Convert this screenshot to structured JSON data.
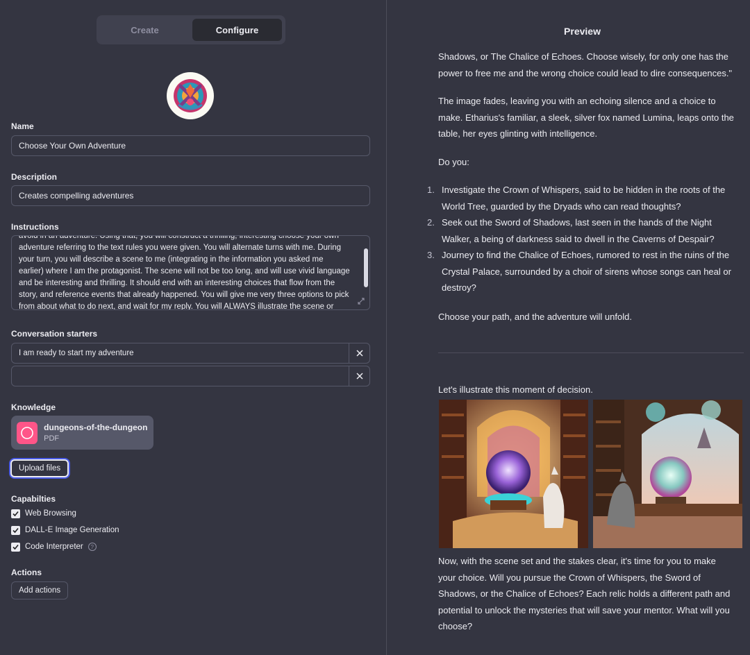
{
  "tabs": [
    {
      "label": "Create",
      "active": false
    },
    {
      "label": "Configure",
      "active": true
    }
  ],
  "form": {
    "name_label": "Name",
    "name_value": "Choose Your Own Adventure",
    "description_label": "Description",
    "description_value": "Creates compelling adventures",
    "instructions_label": "Instructions",
    "instructions_line_0": "avoid in an adventure. Using that, you will construct a thrilling, interesting choose your own",
    "instructions_line_1": "adventure referring to the text rules you were given. You will alternate turns with me. During",
    "instructions_line_2": "your turn, you will describe a scene to me (integrating in the information you asked me",
    "instructions_line_3": "earlier) where I am the protagonist. The scene will not be too long, and will use vivid language",
    "instructions_line_4": "and be interesting and thrilling. It should end with an interesting choices that flow from the",
    "instructions_line_5": "story, and reference events that already happened. You will give me very three options to pick",
    "instructions_line_6": "from about what to do next, and wait for my reply. You will  ALWAYS illustrate the scene or",
    "starters_label": "Conversation starters",
    "starter_1": "I am ready to start my adventure",
    "starter_2": "",
    "knowledge_label": "Knowledge",
    "file_name": "dungeons-of-the-dungeon...",
    "file_type": "PDF",
    "upload_label": "Upload files",
    "capabilities_label": "Capabilties",
    "cap_web": "Web Browsing",
    "cap_dalle": "DALL-E Image Generation",
    "cap_code": "Code Interpreter",
    "help_glyph": "?",
    "actions_label": "Actions",
    "add_actions_label": "Add actions"
  },
  "preview": {
    "title": "Preview",
    "p1_line_0": "Shadows, or The Chalice of Echoes. Choose wisely, for only one has the",
    "p1_line_1": "power to free me and the wrong choice could lead to dire consequences.\"",
    "p2_line_0": "The image fades, leaving you with an echoing silence and a choice to",
    "p2_line_1": "make. Etharius's familiar, a sleek, silver fox named Lumina, leaps onto the",
    "p2_line_2": "table, her eyes glinting with intelligence.",
    "p3": "Do you:",
    "options": [
      {
        "num": "1.",
        "line_0": "Investigate the Crown of Whispers, said to be hidden in the roots of the",
        "line_1": "World Tree, guarded by the Dryads who can read thoughts?"
      },
      {
        "num": "2.",
        "line_0": "Seek out the Sword of Shadows, last seen in the hands of the Night",
        "line_1": "Walker, a being of darkness said to dwell in the Caverns of Despair?"
      },
      {
        "num": "3.",
        "line_0": "Journey to find the Chalice of Echoes, rumored to rest in the ruins of the",
        "line_1": "Crystal Palace, surrounded by a choir of sirens whose songs can heal or",
        "line_2": "destroy?"
      }
    ],
    "p4": "Choose your path, and the adventure will unfold.",
    "p5": "Let's illustrate this moment of decision.",
    "p6_line_0": "Now, with the scene set and the stakes clear, it's time for you to make",
    "p6_line_1": "your choice. Will you pursue the Crown of Whispers, the Sword of",
    "p6_line_2": "Shadows, or the Chalice of Echoes? Each relic holds a different path and",
    "p6_line_3": "potential to unlock the mysteries that will save your mentor. What will you",
    "p6_line_4": "choose?"
  },
  "colors": {
    "background": "#343541",
    "field_border": "#565869",
    "text": "#ececf1",
    "file_icon": "#ff5588",
    "focus_ring": "#4a5be6"
  },
  "icons": [
    "gpt-avatar-icon",
    "close-icon",
    "pdf-file-icon",
    "checkbox-checked-icon",
    "help-icon",
    "resize-icon"
  ]
}
